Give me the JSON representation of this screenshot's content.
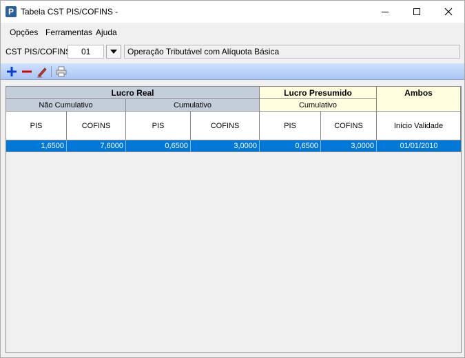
{
  "window": {
    "title": "Tabela CST PIS/COFINS -",
    "icon_letter": "P",
    "controls": [
      "minimize-icon",
      "maximize-icon",
      "close-icon"
    ]
  },
  "menu": {
    "opcoes": "Opções",
    "ferramentas": "Ferramentas",
    "ajuda": "Ajuda"
  },
  "cst": {
    "label": "CST PIS/COFINS:",
    "value": "01",
    "description": "Operação Tributável com Alíquota Básica"
  },
  "toolbar": {
    "icons": [
      "plus-icon",
      "minus-icon",
      "edit-pencil-icon",
      "printer-icon"
    ],
    "colors": {
      "add": "#0a3fc7",
      "remove": "#d40000"
    }
  },
  "grid": {
    "groups": {
      "lucro_real": "Lucro Real",
      "lucro_presumido": "Lucro Presumido",
      "ambos": "Ambos"
    },
    "subgroups": {
      "nao_cumulativo": "Não Cumulativo",
      "cumulativo_real": "Cumulativo",
      "cumulativo_presumido": "Cumulativo"
    },
    "columns": [
      "PIS",
      "COFINS",
      "PIS",
      "COFINS",
      "PIS",
      "COFINS",
      "Início Validade"
    ],
    "rows": [
      [
        "1,6500",
        "7,6000",
        "0,6500",
        "3,0000",
        "0,6500",
        "3,0000",
        "01/01/2010"
      ]
    ],
    "colors": {
      "header_real": "#c4cedb",
      "header_presumido": "#ffffe0",
      "selected_row": "#0078d7"
    }
  }
}
